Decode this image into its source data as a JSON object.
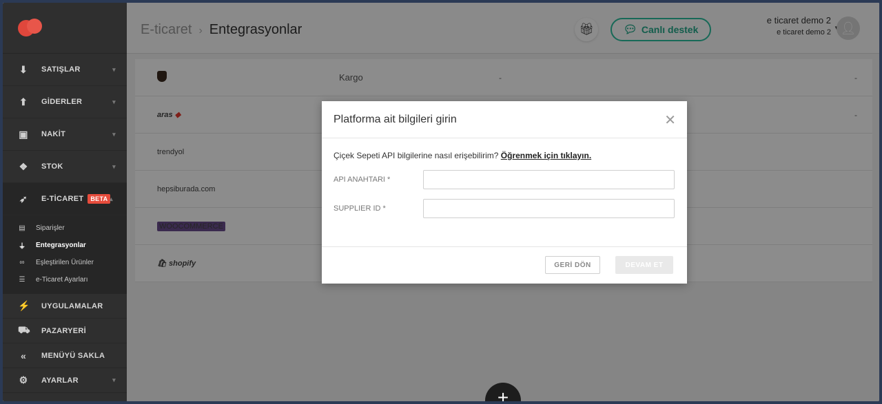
{
  "header": {
    "breadcrumb_parent": "E-ticaret",
    "breadcrumb_sep": "›",
    "breadcrumb_current": "Entegrasyonlar",
    "support_label": "Canlı destek",
    "user_name": "e ticaret demo 2",
    "user_company": "e ticaret demo 2"
  },
  "sidebar": {
    "items": [
      {
        "label": "SATIŞLAR"
      },
      {
        "label": "GİDERLER"
      },
      {
        "label": "NAKİT"
      },
      {
        "label": "STOK"
      },
      {
        "label": "E-TİCARET",
        "badge": "BETA"
      },
      {
        "label": "UYGULAMALAR"
      },
      {
        "label": "PAZARYERİ"
      },
      {
        "label": "MENÜYÜ SAKLA"
      },
      {
        "label": "AYARLAR"
      }
    ],
    "sub_items": [
      {
        "label": "Siparişler"
      },
      {
        "label": "Entegrasyonlar"
      },
      {
        "label": "Eşleştirilen Ürünler"
      },
      {
        "label": "e-Ticaret Ayarları"
      }
    ]
  },
  "integrations": {
    "rows": [
      {
        "logo": "ups",
        "name": "Kargo",
        "col2": "-",
        "col3": "-"
      },
      {
        "logo": "aras",
        "logo_text": "aras",
        "name": "",
        "col2": "",
        "col3": "-"
      },
      {
        "logo": "trendyol",
        "logo_text": "trendyol",
        "name": "",
        "col2": "",
        "col3": ""
      },
      {
        "logo": "hepsiburada",
        "logo_text": "hepsiburada.com",
        "name": "",
        "col2": "",
        "col3": ""
      },
      {
        "logo": "woocommerce",
        "logo_text": "WOOCOMMERCE",
        "name": "",
        "col2": "",
        "col3": ""
      },
      {
        "logo": "shopify",
        "logo_text": "shopify",
        "name": "",
        "col2": "",
        "col3": ""
      }
    ]
  },
  "modal": {
    "title": "Platforma ait bilgileri girin",
    "info_text": "Çiçek Sepeti API bilgilerine nasıl erişebilirim?",
    "info_link": "Öğrenmek için tıklayın.",
    "fields": [
      {
        "label": "API ANAHTARI *",
        "value": "",
        "placeholder": ""
      },
      {
        "label": "SUPPLIER ID *",
        "value": "",
        "placeholder": ""
      }
    ],
    "back_label": "GERİ DÖN",
    "next_label": "DEVAM ET"
  },
  "fab": {
    "label": "+"
  },
  "colors": {
    "sidebar_bg": "#2f2f2f",
    "accent_green": "#2bbf9e",
    "beta_red": "#e74c3c"
  }
}
